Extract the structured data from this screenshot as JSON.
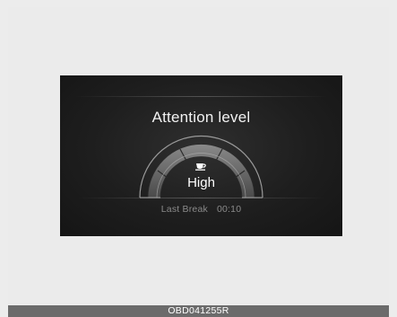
{
  "display": {
    "title": "Attention level",
    "level_label": "High",
    "cup_icon": "coffee-cup-icon",
    "last_break_label": "Last Break",
    "last_break_time": "00:10",
    "gauge_segments_filled": 5,
    "gauge_segments_total": 5
  },
  "caption": {
    "code": "OBD041255R"
  }
}
